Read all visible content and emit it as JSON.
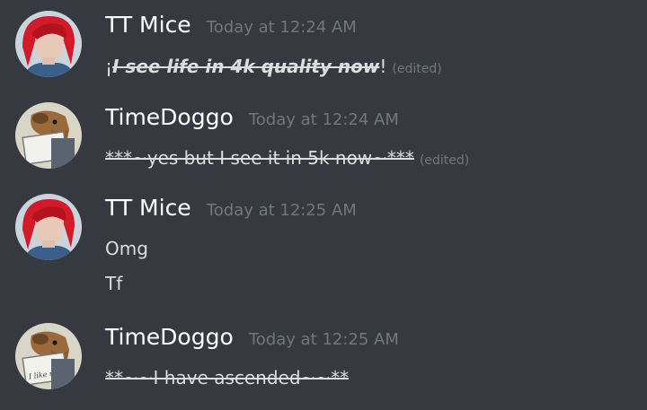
{
  "messages": [
    {
      "username": "TT Mice",
      "timestamp": "Today at 12:24 AM",
      "avatar": "red-hair-person-avatar",
      "lines": [
        {
          "prefix": "¡",
          "text": "I see life in 4k quality now",
          "suffix": "!",
          "edited": "(edited)"
        }
      ]
    },
    {
      "username": "TimeDoggo",
      "timestamp": "Today at 12:24 AM",
      "avatar": "dog-with-sign-avatar",
      "lines": [
        {
          "text": "***~yes but I see it in 5k now~***",
          "edited": "(edited)"
        }
      ]
    },
    {
      "username": "TT Mice",
      "timestamp": "Today at 12:25 AM",
      "avatar": "red-hair-person-avatar",
      "lines": [
        {
          "text": "Omg"
        },
        {
          "text": "Tf"
        }
      ]
    },
    {
      "username": "TimeDoggo",
      "timestamp": "Today at 12:25 AM",
      "avatar": "dog-with-sign-avatar",
      "sign_text": "I like rats!",
      "lines": [
        {
          "text": "**~~I have ascended~~**"
        }
      ]
    }
  ],
  "colors": {
    "background": "#36393f",
    "username": "#ffffff",
    "timestamp": "#72767d",
    "message": "#dcddde"
  }
}
